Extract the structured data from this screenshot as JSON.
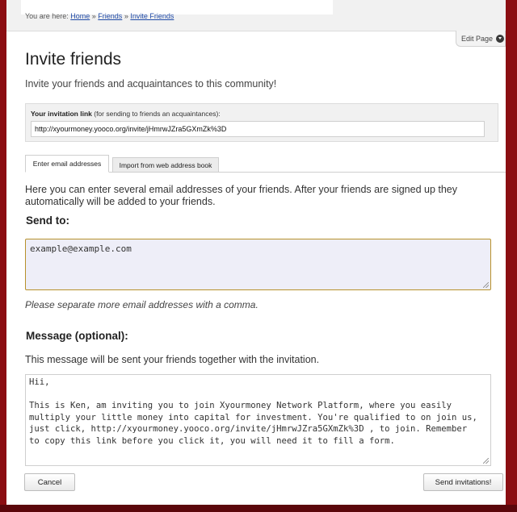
{
  "breadcrumb": {
    "prefix": "You are here:",
    "items": [
      "Home",
      "Friends",
      "Invite Friends"
    ],
    "separator": "»"
  },
  "edit_page": {
    "label": "Edit Page",
    "icon": "chevron-down-icon"
  },
  "page": {
    "title": "Invite friends",
    "intro": "Invite your friends and acquaintances to this community!"
  },
  "invitation": {
    "label_bold": "Your invitation link",
    "label_rest": " (for sending to friends an acquaintances):",
    "link": "http://xyourmoney.yooco.org/invite/jHmrwJZra5GXmZk%3D"
  },
  "tabs": [
    {
      "label": "Enter email addresses",
      "active": true
    },
    {
      "label": "Import from web address book",
      "active": false
    }
  ],
  "email_section": {
    "description": "Here you can enter several email addresses of your friends. After your friends are signed up they automatically will be added to your friends.",
    "label": "Send to:",
    "value": "example@example.com",
    "hint": "Please separate more email addresses with a comma."
  },
  "message_section": {
    "label": "Message (optional):",
    "description": "This message will be sent your friends together with the invitation.",
    "value": "Hii,\n\nThis is Ken, am inviting you to join Xyourmoney Network Platform, where you easily multiply your little money into capital for investment. You're qualified to on join us, just click, http://xyourmoney.yooco.org/invite/jHmrwJZra5GXmZk%3D , to join. Remember to copy this link before you click it, you will need it to fill a form."
  },
  "buttons": {
    "cancel": "Cancel",
    "send": "Send invitations!"
  },
  "colors": {
    "background": "#7a0a0f",
    "email_border": "#b8912c",
    "link": "#1f4aa8"
  }
}
